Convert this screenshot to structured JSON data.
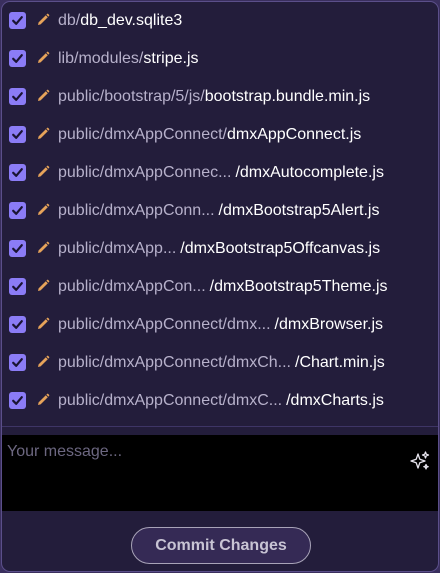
{
  "colors": {
    "accent": "#8b7cf6",
    "pencil": "#e6a35a",
    "panel_bg": "#231d3b",
    "dir_text": "#b7b1cb",
    "name_text": "#ffffff"
  },
  "files": [
    {
      "dir": "db/",
      "name": "db_dev.sqlite3",
      "checked": true,
      "icon": "pencil-icon"
    },
    {
      "dir": "lib/modules/",
      "name": "stripe.js",
      "checked": true,
      "icon": "pencil-icon"
    },
    {
      "dir": "public/bootstrap/5/js/",
      "name": "bootstrap.bundle.min.js",
      "checked": true,
      "icon": "pencil-icon"
    },
    {
      "dir": "public/dmxAppConnect/",
      "name": "dmxAppConnect.js",
      "checked": true,
      "icon": "pencil-icon"
    },
    {
      "dir": "public/dmxAppConnec...",
      "name": "/dmxAutocomplete.js",
      "checked": true,
      "icon": "pencil-icon"
    },
    {
      "dir": "public/dmxAppConn...",
      "name": "/dmxBootstrap5Alert.js",
      "checked": true,
      "icon": "pencil-icon"
    },
    {
      "dir": "public/dmxApp...",
      "name": "/dmxBootstrap5Offcanvas.js",
      "checked": true,
      "icon": "pencil-icon"
    },
    {
      "dir": "public/dmxAppCon...",
      "name": "/dmxBootstrap5Theme.js",
      "checked": true,
      "icon": "pencil-icon"
    },
    {
      "dir": "public/dmxAppConnect/dmx...",
      "name": "/dmxBrowser.js",
      "checked": true,
      "icon": "pencil-icon"
    },
    {
      "dir": "public/dmxAppConnect/dmxCh...",
      "name": "/Chart.min.js",
      "checked": true,
      "icon": "pencil-icon"
    },
    {
      "dir": "public/dmxAppConnect/dmxC...",
      "name": "/dmxCharts.js",
      "checked": true,
      "icon": "pencil-icon"
    }
  ],
  "message": {
    "placeholder": "Your message...",
    "value": "",
    "icon": "sparkle-icon"
  },
  "commit_button": {
    "label": "Commit Changes"
  }
}
